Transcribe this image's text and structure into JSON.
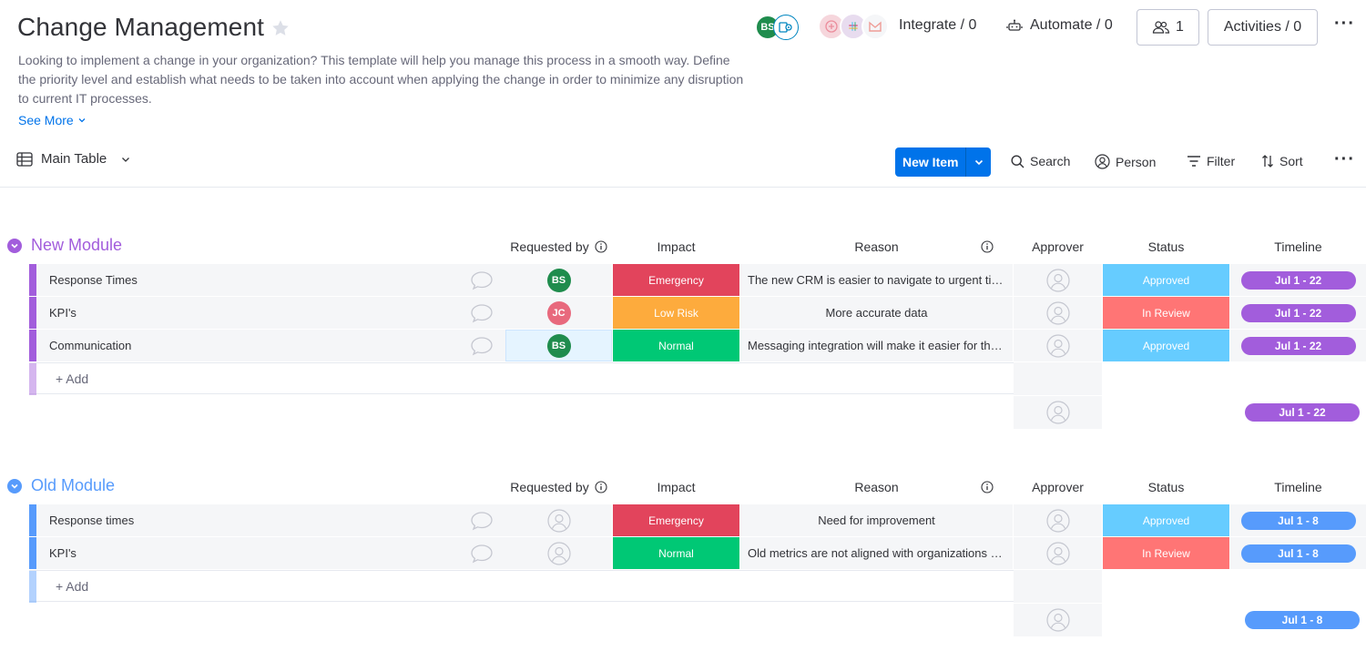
{
  "board": {
    "title": "Change Management",
    "description": "Looking to implement a change in your organization? This template will help you manage this process in a smooth way. Define the priority level and establish what needs to be taken into account when applying the change in order to minimize any disruption to current IT processes.",
    "see_more": "See More"
  },
  "header": {
    "owner_initials": "BS",
    "integrate": "Integrate / 0",
    "automate": "Automate / 0",
    "members": "1",
    "activities": "Activities / 0"
  },
  "toolbar": {
    "view_name": "Main Table",
    "new_item": "New Item",
    "search": "Search",
    "person": "Person",
    "filter": "Filter",
    "sort": "Sort"
  },
  "columns": {
    "requested_by": "Requested by",
    "impact": "Impact",
    "reason": "Reason",
    "approver": "Approver",
    "status": "Status",
    "timeline": "Timeline"
  },
  "colors": {
    "new_module": "#a25ddc",
    "old_module": "#579bfc",
    "emergency": "#e2445c",
    "low_risk": "#fdab3d",
    "normal": "#00c875",
    "approved": "#66ccff",
    "in_review": "#ff7575",
    "avatar_bs": "#1f8c4d",
    "avatar_jc": "#e8697d"
  },
  "groups": [
    {
      "title": "New Module",
      "add_label": "+ Add",
      "summary_timeline": "Jul 1 - 22",
      "rows": [
        {
          "name": "Response Times",
          "requested_by": "BS",
          "impact": "Emergency",
          "reason": "The new CRM is easier to navigate to urgent tickets",
          "status": "Approved",
          "timeline": "Jul 1 - 22"
        },
        {
          "name": "KPI's",
          "requested_by": "JC",
          "impact": "Low Risk",
          "reason": "More accurate data",
          "status": "In Review",
          "timeline": "Jul 1 - 22"
        },
        {
          "name": "Communication",
          "requested_by": "BS",
          "impact": "Normal",
          "reason": "Messaging integration will make it easier for the team",
          "status": "Approved",
          "timeline": "Jul 1 - 22"
        }
      ]
    },
    {
      "title": "Old Module",
      "add_label": "+ Add",
      "summary_timeline": "Jul 1 - 8",
      "rows": [
        {
          "name": "Response times",
          "requested_by": "",
          "impact": "Emergency",
          "reason": "Need for improvement",
          "status": "Approved",
          "timeline": "Jul 1 - 8"
        },
        {
          "name": "KPI's",
          "requested_by": "",
          "impact": "Normal",
          "reason": "Old metrics are not aligned with organizations goals",
          "status": "In Review",
          "timeline": "Jul 1 - 8"
        }
      ]
    }
  ]
}
